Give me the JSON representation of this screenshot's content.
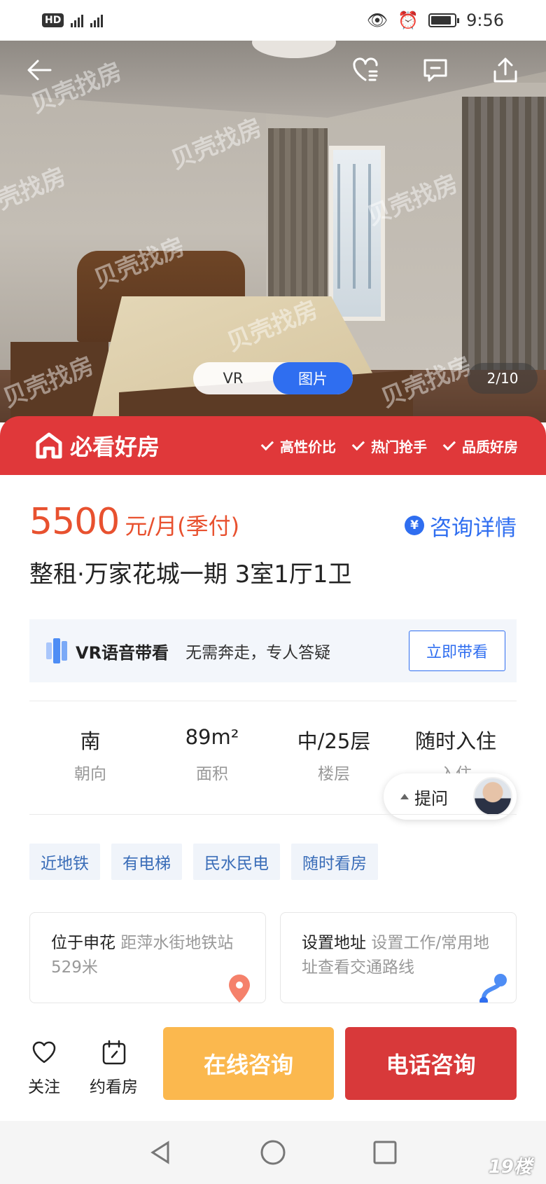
{
  "status_bar": {
    "network": "HD 4G 4G",
    "time": "9:56"
  },
  "hero": {
    "watermark": "贝壳找房",
    "toggle": {
      "vr": "VR",
      "photo": "图片"
    },
    "counter": "2/10"
  },
  "banner": {
    "title": "必看好房",
    "tags": [
      "高性价比",
      "热门抢手",
      "品质好房"
    ]
  },
  "listing": {
    "price": "5500",
    "price_unit": "元/月(季付)",
    "consult_label": "咨询详情",
    "title": "整租·万家花城一期 3室1厅1卫"
  },
  "vr_card": {
    "label": "VR语音带看",
    "description": "无需奔走，专人答疑",
    "button": "立即带看"
  },
  "stats": [
    {
      "value": "南",
      "key": "朝向"
    },
    {
      "value": "89m²",
      "key": "面积"
    },
    {
      "value": "中/25层",
      "key": "楼层"
    },
    {
      "value": "随时入住",
      "key": "入住"
    }
  ],
  "ask": {
    "label": "提问"
  },
  "tags": [
    "近地铁",
    "有电梯",
    "民水民电",
    "随时看房"
  ],
  "location_cards": [
    {
      "highlight": "位于申花",
      "detail": "距萍水街地铁站529米"
    },
    {
      "highlight": "设置地址",
      "detail": "设置工作/常用地址查看交通路线"
    }
  ],
  "actions": {
    "follow": "关注",
    "schedule": "约看房",
    "online": "在线咨询",
    "phone": "电话咨询"
  },
  "site_watermark": "19楼",
  "colors": {
    "price": "#e8512f",
    "banner": "#e0383a",
    "primary": "#2f6ef0",
    "online_btn": "#fbb84e",
    "phone_btn": "#d8393a"
  }
}
